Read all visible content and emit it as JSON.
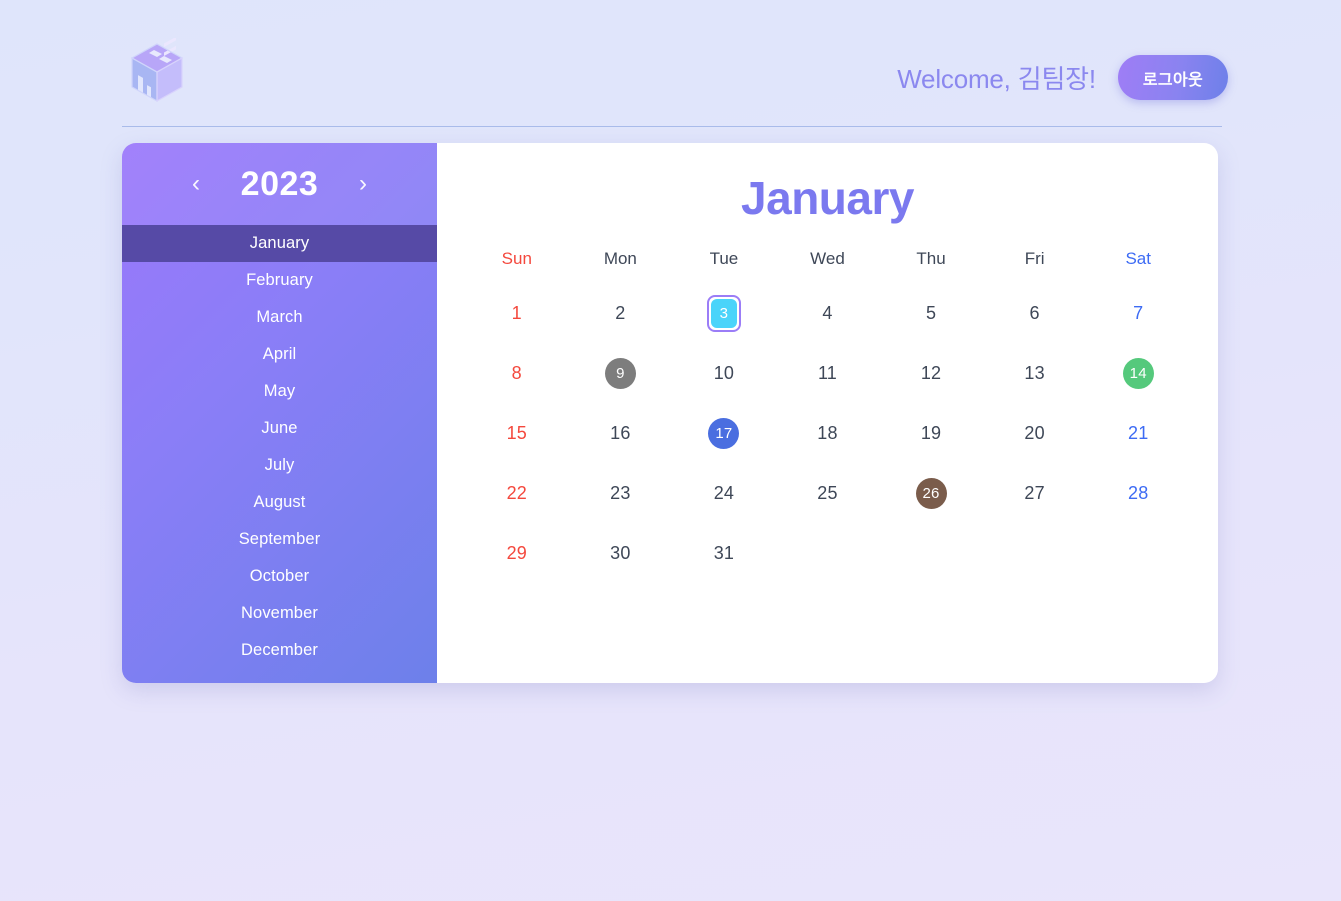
{
  "header": {
    "logo_icon": "isometric-cube-logo",
    "welcome_text": "Welcome, 김팀장!",
    "logout_label": "로그아웃",
    "accent_color": "#8b88ef",
    "logout_gradient_from": "#9f7df6",
    "logout_gradient_to": "#6d80e9"
  },
  "sidebar": {
    "year": "2023",
    "prev_year_icon": "chevron-left-icon",
    "next_year_icon": "chevron-right-icon",
    "prev_arrow": "‹",
    "next_arrow": "›",
    "active_month": "January",
    "active_highlight_color": "#564aa6",
    "gradient_from": "#9b78fb",
    "gradient_to": "#6d80ea",
    "months": [
      {
        "label": "January"
      },
      {
        "label": "February"
      },
      {
        "label": "March"
      },
      {
        "label": "April"
      },
      {
        "label": "May"
      },
      {
        "label": "June"
      },
      {
        "label": "July"
      },
      {
        "label": "August"
      },
      {
        "label": "September"
      },
      {
        "label": "October"
      },
      {
        "label": "November"
      },
      {
        "label": "December"
      }
    ]
  },
  "calendar": {
    "title": "January",
    "title_color": "#7b79ef",
    "weekday_labels": [
      {
        "label": "Sun",
        "kind": "sun"
      },
      {
        "label": "Mon",
        "kind": "weekday"
      },
      {
        "label": "Tue",
        "kind": "weekday"
      },
      {
        "label": "Wed",
        "kind": "weekday"
      },
      {
        "label": "Thu",
        "kind": "weekday"
      },
      {
        "label": "Fri",
        "kind": "weekday"
      },
      {
        "label": "Sat",
        "kind": "sat"
      }
    ],
    "sunday_color": "#f4483d",
    "saturday_color": "#3d6bf4",
    "selected_day": "3",
    "selected_fill": "#4ad4fa",
    "selected_outline": "#9b7df7",
    "weeks": [
      [
        {
          "label": "1",
          "kind": "sun"
        },
        {
          "label": "2",
          "kind": "weekday"
        },
        {
          "label": "3",
          "kind": "weekday",
          "selected": true,
          "fill": "#4ad4fa"
        },
        {
          "label": "4",
          "kind": "weekday"
        },
        {
          "label": "5",
          "kind": "weekday"
        },
        {
          "label": "6",
          "kind": "weekday"
        },
        {
          "label": "7",
          "kind": "sat"
        }
      ],
      [
        {
          "label": "8",
          "kind": "sun"
        },
        {
          "label": "9",
          "kind": "weekday",
          "marked": true,
          "fill": "#7d7d7d"
        },
        {
          "label": "10",
          "kind": "weekday"
        },
        {
          "label": "11",
          "kind": "weekday"
        },
        {
          "label": "12",
          "kind": "weekday"
        },
        {
          "label": "13",
          "kind": "weekday"
        },
        {
          "label": "14",
          "kind": "sat",
          "marked": true,
          "fill": "#55c97c"
        }
      ],
      [
        {
          "label": "15",
          "kind": "sun"
        },
        {
          "label": "16",
          "kind": "weekday"
        },
        {
          "label": "17",
          "kind": "weekday",
          "marked": true,
          "fill": "#4a6ee0"
        },
        {
          "label": "18",
          "kind": "weekday"
        },
        {
          "label": "19",
          "kind": "weekday"
        },
        {
          "label": "20",
          "kind": "weekday"
        },
        {
          "label": "21",
          "kind": "sat"
        }
      ],
      [
        {
          "label": "22",
          "kind": "sun"
        },
        {
          "label": "23",
          "kind": "weekday"
        },
        {
          "label": "24",
          "kind": "weekday"
        },
        {
          "label": "25",
          "kind": "weekday"
        },
        {
          "label": "26",
          "kind": "weekday",
          "marked": true,
          "fill": "#7a5c4b"
        },
        {
          "label": "27",
          "kind": "weekday"
        },
        {
          "label": "28",
          "kind": "sat"
        }
      ],
      [
        {
          "label": "29",
          "kind": "sun"
        },
        {
          "label": "30",
          "kind": "weekday"
        },
        {
          "label": "31",
          "kind": "weekday"
        },
        {
          "label": "",
          "kind": "empty"
        },
        {
          "label": "",
          "kind": "empty"
        },
        {
          "label": "",
          "kind": "empty"
        },
        {
          "label": "",
          "kind": "empty"
        }
      ]
    ]
  },
  "page": {
    "background_from": "#dfe5fb",
    "background_to": "#e9e5fb",
    "divider_color": "#a9bbea"
  }
}
